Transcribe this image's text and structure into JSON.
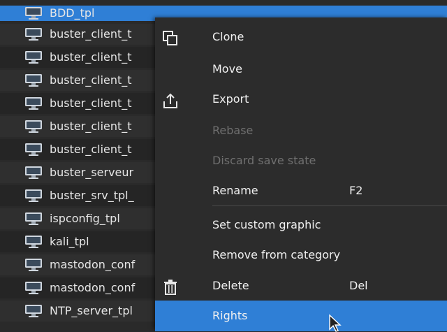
{
  "list": {
    "items": [
      {
        "label": "BDD_tpl"
      },
      {
        "label": "buster_client_t"
      },
      {
        "label": "buster_client_t"
      },
      {
        "label": "buster_client_t"
      },
      {
        "label": "buster_client_t"
      },
      {
        "label": "buster_client_t"
      },
      {
        "label": "buster_client_t"
      },
      {
        "label": "buster_serveur"
      },
      {
        "label": "buster_srv_tpl_"
      },
      {
        "label": "ispconfig_tpl"
      },
      {
        "label": "kali_tpl"
      },
      {
        "label": "mastodon_conf"
      },
      {
        "label": "mastodon_conf"
      },
      {
        "label": "NTP_server_tpl"
      }
    ],
    "icon": "monitor-icon"
  },
  "context_menu": {
    "items": [
      {
        "label": "Clone",
        "icon": "clone-icon"
      },
      {
        "label": "Move"
      },
      {
        "label": "Export",
        "icon": "export-icon"
      },
      {
        "label": "Rebase",
        "disabled": true
      },
      {
        "label": "Discard save state",
        "disabled": true
      },
      {
        "label": "Rename",
        "shortcut": "F2"
      },
      {
        "label": "Set custom graphic"
      },
      {
        "label": "Remove from category"
      },
      {
        "label": "Delete",
        "shortcut": "Del",
        "icon": "trash-icon"
      },
      {
        "label": "Rights",
        "selected": true
      }
    ]
  },
  "colors": {
    "selection": "#2f7fd6",
    "background": "#2a2a2a",
    "disabled_text": "#6f6f6f"
  }
}
